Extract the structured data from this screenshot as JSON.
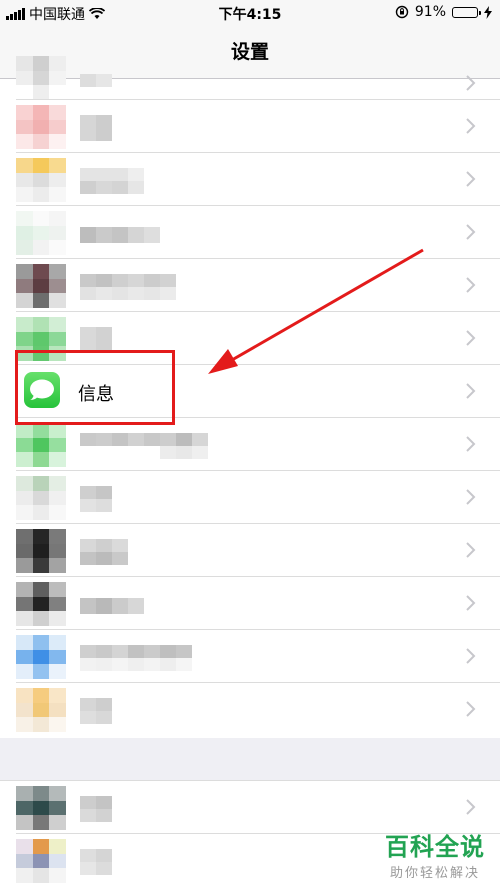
{
  "status_bar": {
    "carrier": "中国联通",
    "time": "下午4:15",
    "battery": "91%",
    "battery_level": 0.91,
    "icons": [
      "signal-icon",
      "wifi-icon",
      "orientation-lock-icon",
      "battery-icon",
      "charging-bolt-icon"
    ]
  },
  "nav": {
    "title": "设置"
  },
  "highlighted_row": {
    "label": "信息",
    "icon": "messages-icon"
  },
  "rows_pixelated": 13,
  "watermark": {
    "title": "百科全说",
    "subtitle": "助你轻松解决"
  },
  "colors": {
    "highlight_box": "#e31b1b",
    "arrow": "#e31b1b",
    "messages_green": "#34c759",
    "watermark_green": "#22a352"
  }
}
